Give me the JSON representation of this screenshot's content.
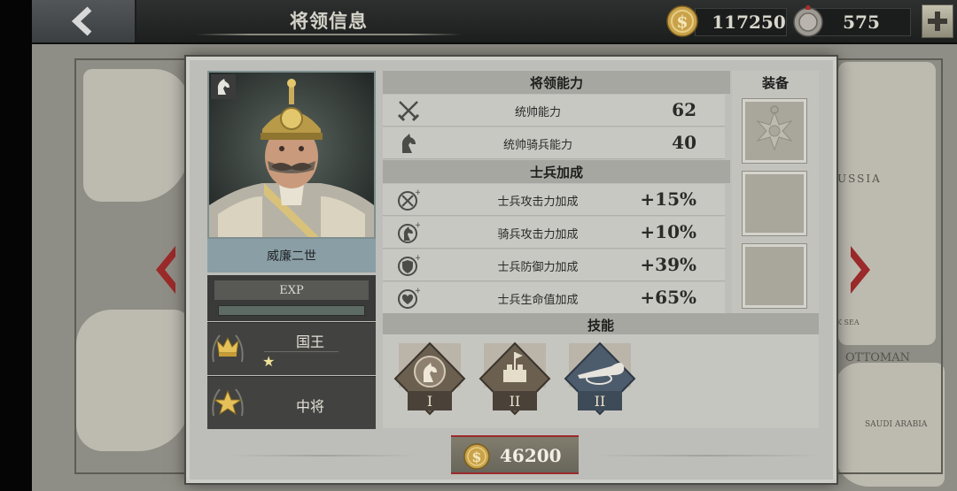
{
  "header": {
    "title": "将领信息",
    "gold": "117250",
    "medals": "575"
  },
  "general": {
    "name": "威廉二世",
    "exp_label": "EXP",
    "title_rank": "国王",
    "title_stars": "★",
    "military_rank": "中将"
  },
  "abilities": {
    "header": "将领能力",
    "items": [
      {
        "label": "统帅能力",
        "value": "62",
        "icon": "crossed-swords-icon"
      },
      {
        "label": "统帅骑兵能力",
        "value": "40",
        "icon": "knight-horse-icon"
      }
    ]
  },
  "bonuses": {
    "header": "士兵加成",
    "items": [
      {
        "label": "士兵攻击力加成",
        "value": "+15%",
        "icon": "attack-bonus-icon"
      },
      {
        "label": "骑兵攻击力加成",
        "value": "+10%",
        "icon": "cavalry-bonus-icon"
      },
      {
        "label": "士兵防御力加成",
        "value": "+39%",
        "icon": "defense-bonus-icon"
      },
      {
        "label": "士兵生命值加成",
        "value": "+65%",
        "icon": "health-bonus-icon"
      }
    ]
  },
  "equipment": {
    "header": "装备"
  },
  "skills": {
    "header": "技能",
    "items": [
      {
        "level": "I",
        "icon": "cavalry-medal-icon"
      },
      {
        "level": "II",
        "icon": "fortification-icon"
      },
      {
        "level": "II",
        "icon": "bugle-icon"
      }
    ]
  },
  "cost": {
    "value": "46200"
  },
  "map_labels": {
    "russia": "RUSSIA",
    "sea": "K SEA",
    "ottoman": "OTTOMAN",
    "saudi": "SAUDI ARABIA"
  },
  "colors": {
    "accent_red": "#9b2a2a",
    "panel_bg": "#bdbdb9",
    "gold": "#c9a24a"
  }
}
